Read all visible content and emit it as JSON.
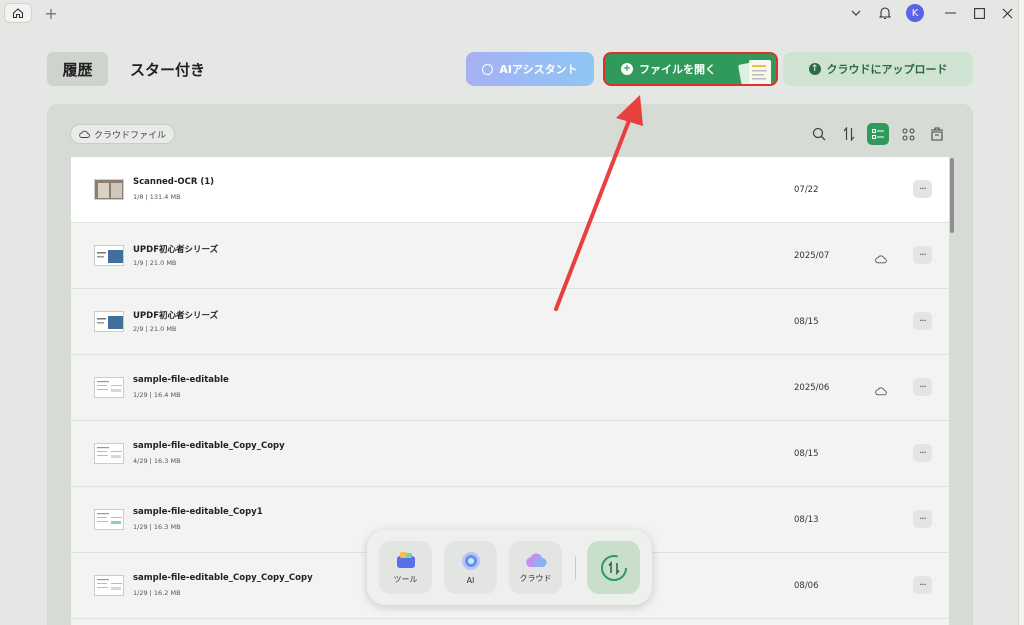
{
  "titlebar": {
    "home_icon": "home-icon",
    "new_tab": "+",
    "avatar_initial": "K"
  },
  "header": {
    "tabs": [
      {
        "label": "履歴",
        "selected": true
      },
      {
        "label": "スター付き",
        "selected": false
      }
    ],
    "buttons": {
      "ai_assistant": "AIアシスタント",
      "open_file": "ファイルを開く",
      "cloud_upload": "クラウドにアップロード"
    }
  },
  "toolbar": {
    "cloud_files": "クラウドファイル"
  },
  "files": [
    {
      "name": "Scanned-OCR (1)",
      "meta": "1/8 | 131.4 MB",
      "date": "07/22",
      "cloud": false,
      "selected": true
    },
    {
      "name": "UPDF初心者シリーズ",
      "meta": "1/9 | 21.0 MB",
      "date": "2025/07",
      "cloud": true,
      "selected": false
    },
    {
      "name": "UPDF初心者シリーズ",
      "meta": "2/9 | 21.0 MB",
      "date": "08/15",
      "cloud": false,
      "selected": false
    },
    {
      "name": "sample-file-editable",
      "meta": "1/29 | 16.4 MB",
      "date": "2025/06",
      "cloud": true,
      "selected": false
    },
    {
      "name": "sample-file-editable_Copy_Copy",
      "meta": "4/29 | 16.3 MB",
      "date": "08/15",
      "cloud": false,
      "selected": false
    },
    {
      "name": "sample-file-editable_Copy1",
      "meta": "1/29 | 16.3 MB",
      "date": "08/13",
      "cloud": false,
      "selected": false
    },
    {
      "name": "sample-file-editable_Copy_Copy_Copy",
      "meta": "1/29 | 16.2 MB",
      "date": "08/06",
      "cloud": false,
      "selected": false
    }
  ],
  "more_label": "···",
  "dock": {
    "tools": "ツール",
    "ai": "AI",
    "cloud": "クラウド"
  },
  "colors": {
    "accent": "#2f9a5c",
    "highlight": "#e0302e",
    "avatar": "#5b63e8"
  }
}
